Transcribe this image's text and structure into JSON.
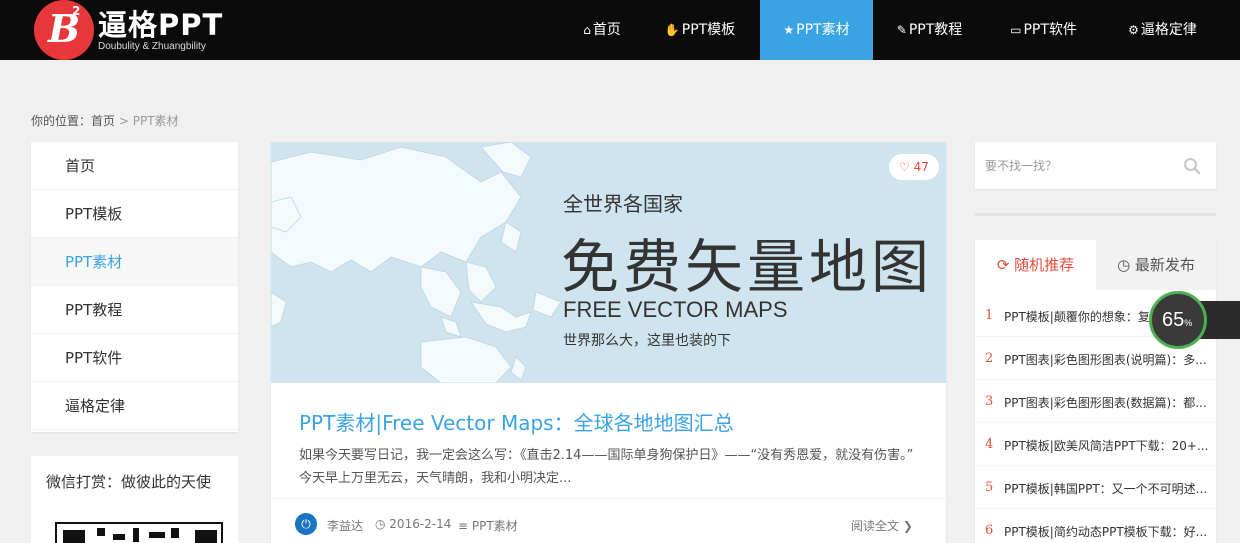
{
  "header": {
    "logo_b": "B",
    "logo_sup": "2",
    "logo_title": "逼格PPT",
    "logo_sub": "Doubulity & Zhuangbility",
    "nav": [
      {
        "label": "首页",
        "icon": "home-icon",
        "glyph": "⌂"
      },
      {
        "label": "PPT模板",
        "icon": "thumbs-up-icon",
        "glyph": "👍"
      },
      {
        "label": "PPT素材",
        "icon": "star-icon",
        "glyph": "★",
        "active": true
      },
      {
        "label": "PPT教程",
        "icon": "edit-icon",
        "glyph": "✎"
      },
      {
        "label": "PPT软件",
        "icon": "monitor-icon",
        "glyph": "▭"
      },
      {
        "label": "逼格定律",
        "icon": "gear-icon",
        "glyph": "⚙"
      }
    ]
  },
  "breadcrumb": {
    "prefix": "你的位置：",
    "home": "首页",
    "sep": ">",
    "current": "PPT素材"
  },
  "leftmenu": {
    "items": [
      "首页",
      "PPT模板",
      "PPT素材",
      "PPT教程",
      "PPT软件",
      "逼格定律"
    ],
    "active_index": 2
  },
  "reward": {
    "title": "微信打赏：做彼此的天使"
  },
  "article": {
    "banner_line1": "全世界各国家",
    "banner_line2": "免费矢量地图",
    "banner_line3": "FREE VECTOR MAPS",
    "banner_line4": "世界那么大，这里也装的下",
    "likes": "47",
    "title": "PPT素材|Free Vector Maps：全球各地地图汇总",
    "excerpt": "如果今天要写日记，我一定会这么写：《直击2.14——国际单身狗保护日》——“没有秀恩爱，就没有伤害。” 今天早上万里无云，天气晴朗，我和小明决定...",
    "author": "李益达",
    "date": "2016-2-14",
    "category": "PPT素材",
    "read_more": "阅读全文"
  },
  "search": {
    "placeholder": "要不找一找？"
  },
  "widget": {
    "tab_random": "随机推荐",
    "tab_latest": "最新发布",
    "items": [
      {
        "num": "1",
        "text": "PPT模板|颠覆你的想象：复..."
      },
      {
        "num": "2",
        "text": "PPT图表|彩色图形图表(说明篇)：多..."
      },
      {
        "num": "3",
        "text": "PPT图表|彩色图形图表(数据篇)：都..."
      },
      {
        "num": "4",
        "text": "PPT模板|欧美风简洁PPT下载：20+..."
      },
      {
        "num": "5",
        "text": "PPT模板|韩国PPT：又一个不可明述..."
      },
      {
        "num": "6",
        "text": "PPT模板|简约动态PPT模板下载：好..."
      }
    ]
  },
  "speed_widget": {
    "value": "65",
    "unit": "%"
  },
  "colors": {
    "accent": "#3aa3e3",
    "brand_red": "#e8373a",
    "header_bg": "#0b0b0b",
    "highlight_red": "#e74c3c"
  }
}
